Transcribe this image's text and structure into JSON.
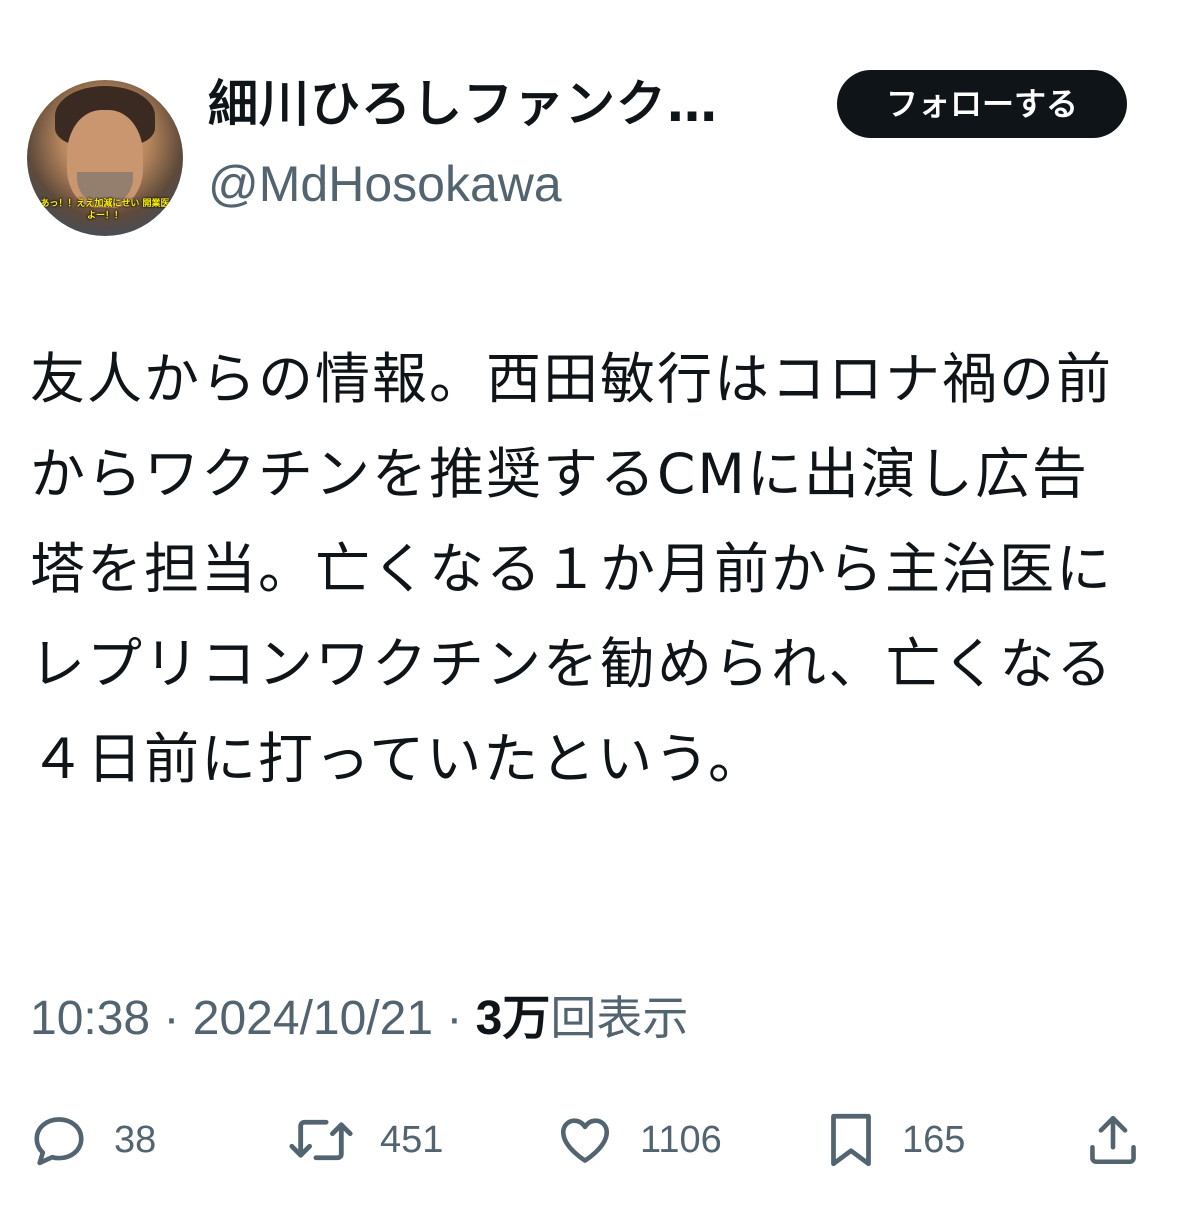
{
  "author": {
    "display_name": "細川ひろしファンク…",
    "handle": "@MdHosokawa",
    "avatar_caption": "あっ！！ええ加減にせい 開業医よー！！"
  },
  "follow_button": {
    "label": "フォローする"
  },
  "tweet": {
    "text": "友人からの情報。西田敏行はコロナ禍の前からワクチンを推奨するCMに出演し広告塔を担当。亡くなる１か月前から主治医にレプリコンワクチンを勧められ、亡くなる４日前に打っていたという。",
    "time": "10:38",
    "separator": " · ",
    "date": "2024/10/21",
    "views_count": "3万",
    "views_label": "回表示"
  },
  "actions": {
    "replies": {
      "icon": "reply-icon",
      "count": "38"
    },
    "retweets": {
      "icon": "retweet-icon",
      "count": "451"
    },
    "likes": {
      "icon": "heart-icon",
      "count": "1106"
    },
    "bookmarks": {
      "icon": "bookmark-icon",
      "count": "165"
    },
    "share": {
      "icon": "share-icon"
    }
  },
  "colors": {
    "text_primary": "#0f1419",
    "text_secondary": "#536471",
    "button_bg": "#0f1419",
    "button_text": "#ffffff",
    "background": "#ffffff"
  }
}
